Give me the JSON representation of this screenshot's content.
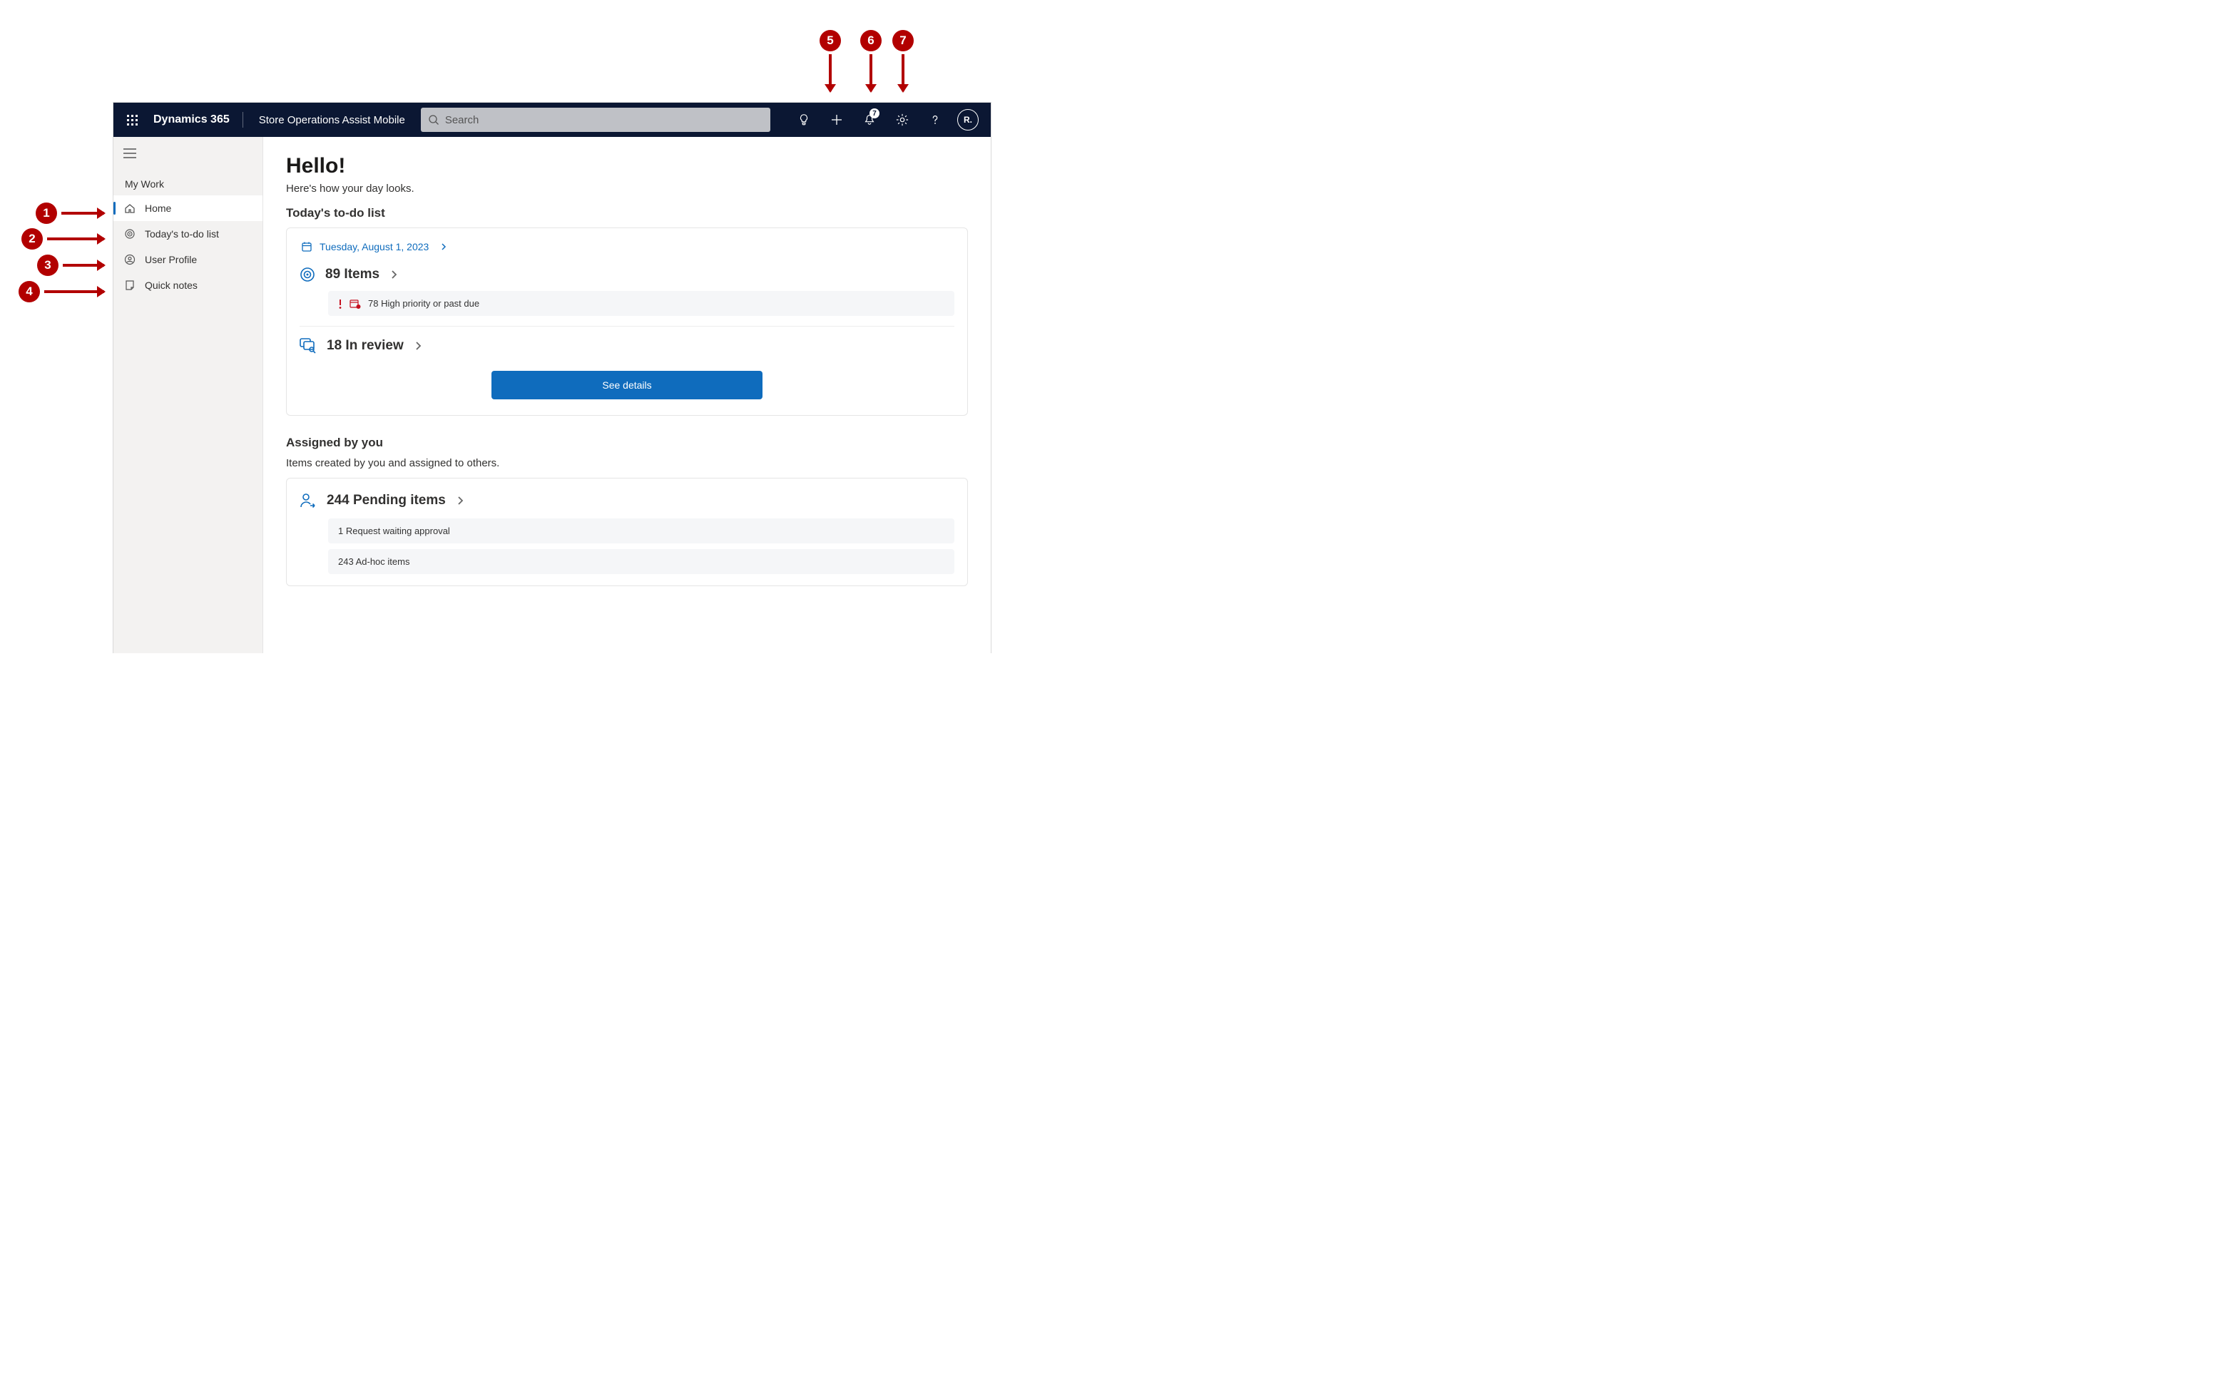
{
  "callouts": {
    "c1": "1",
    "c2": "2",
    "c3": "3",
    "c4": "4",
    "c5": "5",
    "c6": "6",
    "c7": "7"
  },
  "header": {
    "brand": "Dynamics 365",
    "app_title": "Store Operations Assist Mobile",
    "search_placeholder": "Search",
    "notification_badge": "7",
    "avatar_initial": "R."
  },
  "sidebar": {
    "section_label": "My Work",
    "items": [
      {
        "label": "Home"
      },
      {
        "label": "Today's to-do list"
      },
      {
        "label": "User Profile"
      },
      {
        "label": "Quick notes"
      }
    ]
  },
  "main": {
    "greeting": "Hello!",
    "subline": "Here's how your day looks.",
    "todo": {
      "heading": "Today's to-do list",
      "date": "Tuesday, August 1, 2023",
      "items_count_label": "89 Items",
      "high_priority_label": "78 High priority or past due",
      "in_review_label": "18 In review",
      "see_details": "See details"
    },
    "assigned": {
      "heading": "Assigned by you",
      "subline": "Items created by you and assigned to others.",
      "pending_label": "244 Pending items",
      "row1": "1 Request waiting approval",
      "row2": "243 Ad-hoc items"
    }
  }
}
